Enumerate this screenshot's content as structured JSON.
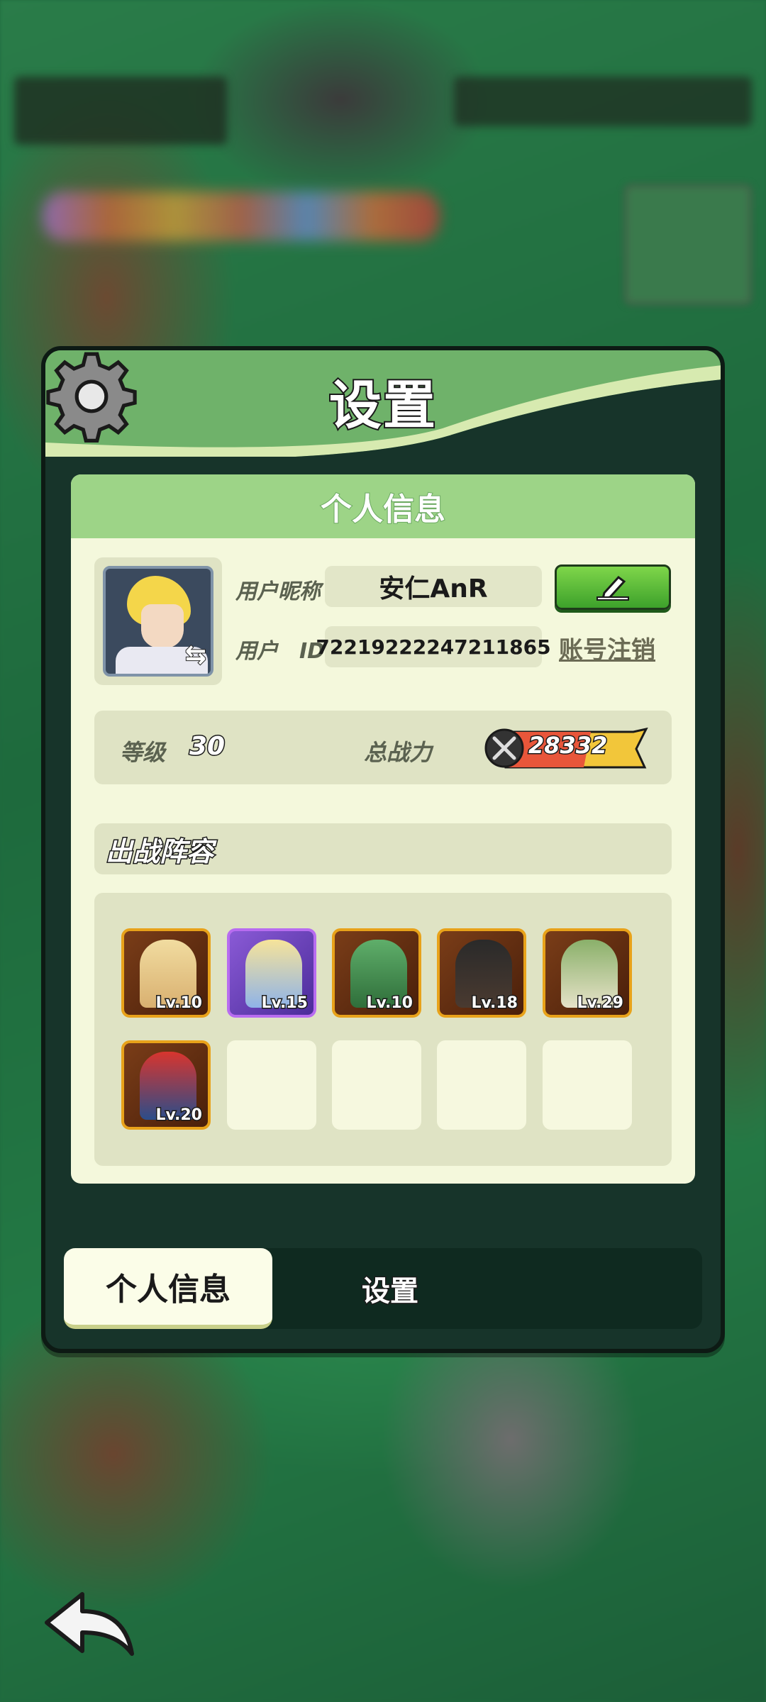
{
  "panel": {
    "title": "设置"
  },
  "profile": {
    "section_title": "个人信息",
    "nickname_label": "用户昵称",
    "nickname_value": "安仁AnR",
    "id_label": "用户　ID",
    "id_value": "72219222247211865",
    "cancel_account_link": "账号注销"
  },
  "stats": {
    "level_label": "等级",
    "level_value": "30",
    "power_label": "总战力",
    "power_value": "28332"
  },
  "lineup": {
    "title": "出战阵容",
    "heroes": [
      {
        "level": "Lv.10"
      },
      {
        "level": "Lv.15"
      },
      {
        "level": "Lv.10"
      },
      {
        "level": "Lv.18"
      },
      {
        "level": "Lv.29"
      },
      {
        "level": "Lv.20"
      }
    ]
  },
  "tabs": {
    "active": "个人信息",
    "other": "设置"
  },
  "icons": {
    "gear": "gear-icon",
    "edit": "pencil-icon",
    "back": "back-arrow-icon",
    "swap": "swap-icon",
    "power": "crossed-swords-icon"
  },
  "colors": {
    "accent_green": "#6fb26a",
    "panel_bg": "#f4f8dc",
    "gold_border": "#e8a21a",
    "purple_border": "#b86cf0"
  }
}
